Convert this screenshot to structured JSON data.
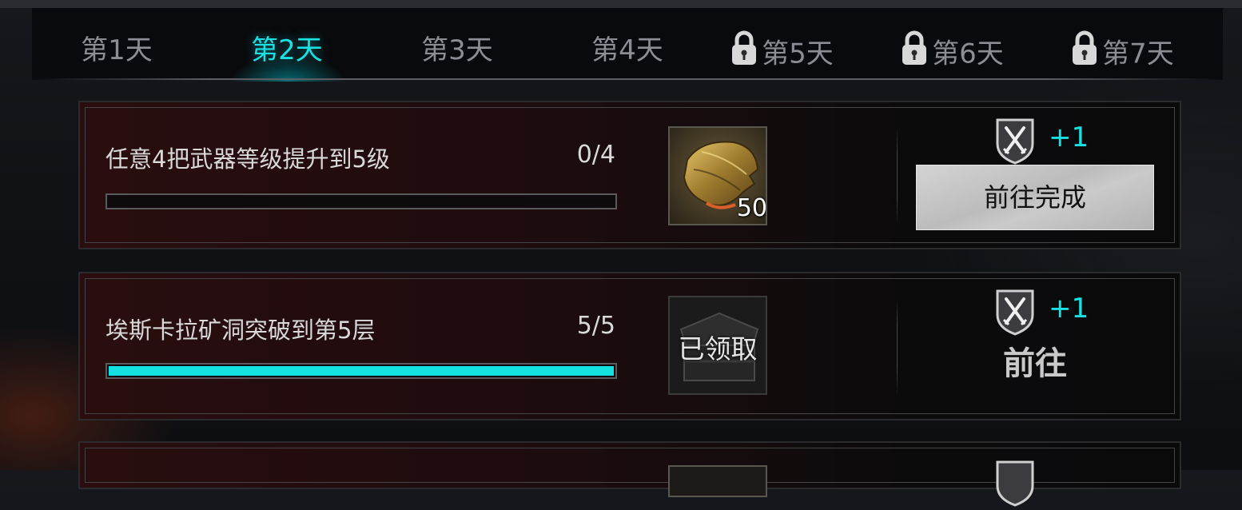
{
  "tabs": [
    {
      "label": "第1天",
      "locked": false,
      "active": false
    },
    {
      "label": "第2天",
      "locked": false,
      "active": true
    },
    {
      "label": "第3天",
      "locked": false,
      "active": false
    },
    {
      "label": "第4天",
      "locked": false,
      "active": false
    },
    {
      "label": "第5天",
      "locked": true,
      "active": false
    },
    {
      "label": "第6天",
      "locked": true,
      "active": false
    },
    {
      "label": "第7天",
      "locked": true,
      "active": false
    }
  ],
  "tasks": [
    {
      "description": "任意4把武器等级提升到5级",
      "progress_text": "0/4",
      "progress_fraction": 0,
      "reward_count": "50",
      "points": "+1",
      "action_label": "前往完成"
    },
    {
      "description": "埃斯卡拉矿洞突破到第5层",
      "progress_text": "5/5",
      "progress_fraction": 1,
      "reward_claimed_label": "已领取",
      "points": "+1",
      "action_label": "前往"
    }
  ],
  "colors": {
    "accent": "#19e0e2",
    "inactive_tab": "#8b8e94"
  }
}
